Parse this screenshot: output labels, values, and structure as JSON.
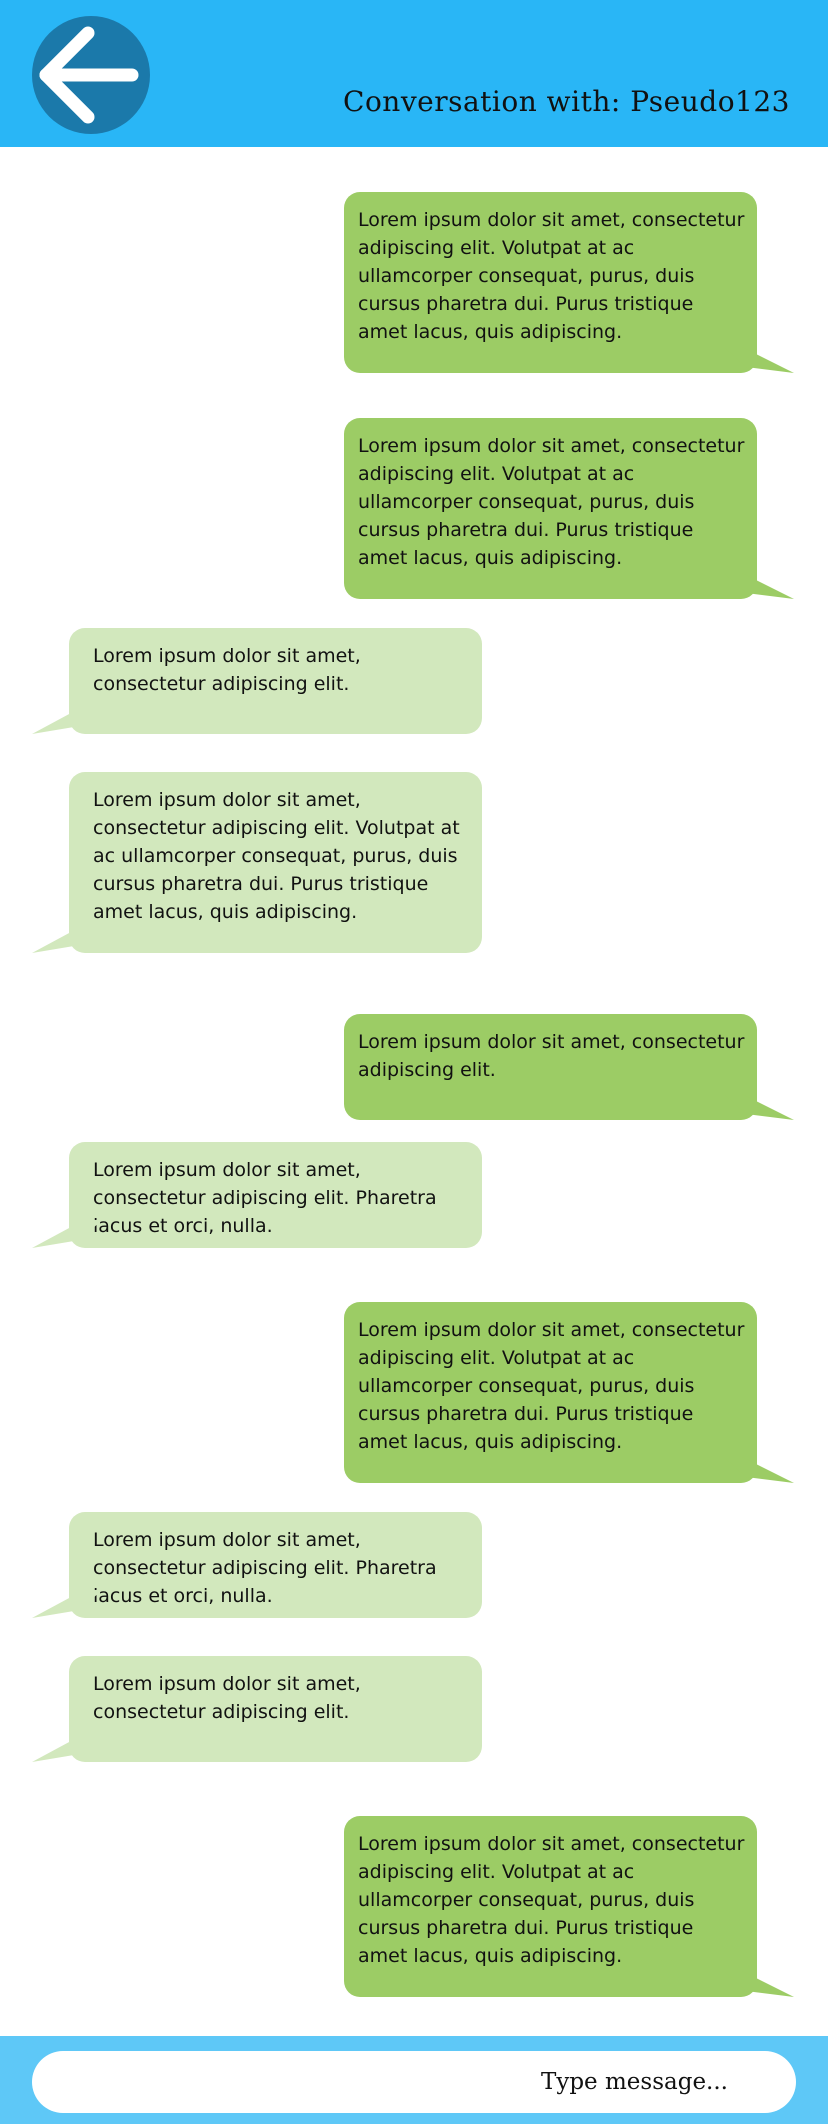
{
  "header": {
    "title": "Conversation with: Pseudo123",
    "back_icon": "arrow-left-icon",
    "color": "#29b6f6"
  },
  "messages": [
    {
      "side": "sent",
      "text": "Lorem ipsum dolor sit amet, consectetur adipiscing elit. Volutpat at ac ullamcorper consequat, purus, duis cursus pharetra dui. Purus tristique amet lacus, quis adipiscing."
    },
    {
      "side": "sent",
      "text": "Lorem ipsum dolor sit amet, consectetur adipiscing elit. Volutpat at ac ullamcorper consequat, purus, duis cursus pharetra dui. Purus tristique amet lacus, quis adipiscing."
    },
    {
      "side": "received",
      "text": "Lorem ipsum dolor sit amet, consectetur adipiscing elit."
    },
    {
      "side": "received",
      "text": "Lorem ipsum dolor sit amet, consectetur adipiscing elit. Volutpat at ac ullamcorper consequat, purus, duis cursus pharetra dui. Purus tristique amet lacus, quis adipiscing."
    },
    {
      "side": "sent",
      "text": "Lorem ipsum dolor sit amet, consectetur adipiscing elit."
    },
    {
      "side": "received",
      "text": "Lorem ipsum dolor sit amet, consectetur adipiscing elit. Pharetra lacus et orci, nulla."
    },
    {
      "side": "sent",
      "text": "Lorem ipsum dolor sit amet, consectetur adipiscing elit. Volutpat at ac ullamcorper consequat, purus, duis cursus pharetra dui. Purus tristique amet lacus, quis adipiscing."
    },
    {
      "side": "received",
      "text": "Lorem ipsum dolor sit amet, consectetur adipiscing elit. Pharetra lacus et orci, nulla."
    },
    {
      "side": "received",
      "text": "Lorem ipsum dolor sit amet, consectetur adipiscing elit."
    },
    {
      "side": "sent",
      "text": "Lorem ipsum dolor sit amet, consectetur adipiscing elit. Volutpat at ac ullamcorper consequat, purus, duis cursus pharetra dui. Purus tristique amet lacus, quis adipiscing."
    }
  ],
  "colors": {
    "sent_bubble": "#9ccc65",
    "received_bubble": "#d2e8bd"
  },
  "composer": {
    "placeholder": "Type message..."
  }
}
